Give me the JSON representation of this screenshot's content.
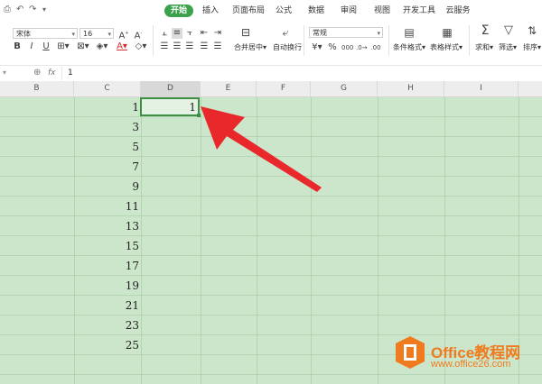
{
  "colors": {
    "accent": "#3ca14b",
    "grid_fill": "#cbe6cb",
    "arrow": "#e8282b",
    "brand": "#f07b1f"
  },
  "quick_access": {
    "icons": [
      "print-preview-icon",
      "undo-icon",
      "redo-icon",
      "more-icon"
    ]
  },
  "tabs": [
    "开始",
    "插入",
    "页面布局",
    "公式",
    "数据",
    "审阅",
    "视图",
    "开发工具",
    "云服务"
  ],
  "active_tab": "开始",
  "font": {
    "name": "宋体",
    "size": "16"
  },
  "buttons": {
    "merge_center": "合并居中",
    "wrap_text": "自动换行",
    "cond_format": "条件格式",
    "table_style": "表格样式",
    "sum": "求和",
    "filter": "筛选",
    "sort": "排序"
  },
  "number_format": "常规",
  "format_glyphs": {
    "bold": "B",
    "italic": "I",
    "underline": "U",
    "percent": "%"
  },
  "formula_bar": {
    "fx": "fx",
    "value": "1"
  },
  "columns": [
    "B",
    "C",
    "D",
    "E",
    "F",
    "G",
    "H",
    "I"
  ],
  "cells": {
    "d1": "1",
    "c_values": [
      "1",
      "3",
      "5",
      "7",
      "9",
      "11",
      "13",
      "15",
      "17",
      "19",
      "21",
      "23",
      "25"
    ]
  },
  "watermark": {
    "brand": "Office教程网",
    "url": "www.office26.com"
  }
}
